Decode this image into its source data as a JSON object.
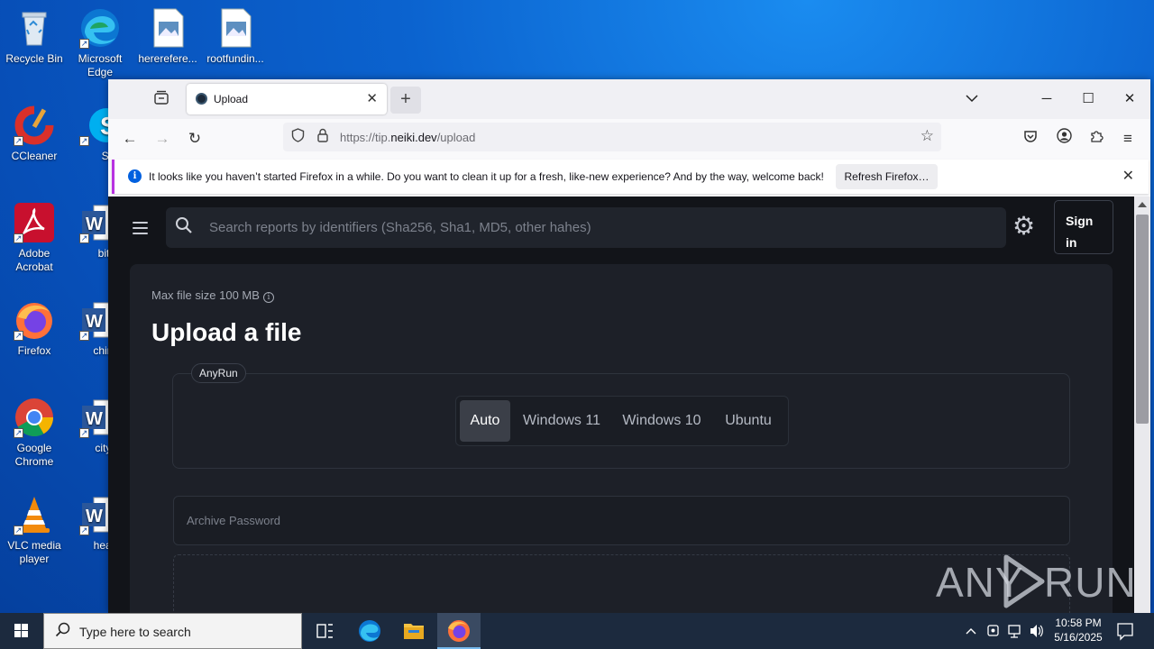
{
  "desktop": {
    "icons": [
      {
        "label": "Recycle Bin"
      },
      {
        "label": "Microsoft Edge"
      },
      {
        "label": "hererefere..."
      },
      {
        "label": "rootfundin..."
      },
      {
        "label": "CCleaner"
      },
      {
        "label": "Skyp"
      },
      {
        "label": "Adobe Acrobat"
      },
      {
        "label": "bitaug"
      },
      {
        "label": "Firefox"
      },
      {
        "label": "chinaca"
      },
      {
        "label": "Google Chrome"
      },
      {
        "label": "cityyea"
      },
      {
        "label": "VLC media player"
      },
      {
        "label": "heartpu"
      }
    ]
  },
  "browser": {
    "tab": {
      "title": "Upload"
    },
    "url": {
      "prefix": "https://tip.",
      "domain": "neiki.dev",
      "path": "/upload"
    },
    "notification": {
      "message": "It looks like you haven’t started Firefox in a while. Do you want to clean it up for a fresh, like-new experience? And by the way, welcome back!",
      "button": "Refresh Firefox…"
    }
  },
  "page": {
    "search_placeholder": "Search reports by identifiers (Sha256, Sha1, MD5, other hahes)",
    "signin": "Sign in",
    "max_file_size": "Max file size 100 MB",
    "heading": "Upload a file",
    "sandbox_tag": "AnyRun",
    "os_options": [
      {
        "label": "Auto",
        "active": true
      },
      {
        "label": "Windows 11",
        "active": false
      },
      {
        "label": "Windows 10",
        "active": false
      },
      {
        "label": "Ubuntu",
        "active": false
      }
    ],
    "archive_password_placeholder": "Archive Password",
    "watermark": "ANY RUN"
  },
  "taskbar": {
    "search_text": "Type here to search",
    "time": "10:58 PM",
    "date": "5/16/2025"
  },
  "colors": {
    "accent_notification": "#b833e1",
    "page_bg": "#121419",
    "card_bg": "#1d2028"
  }
}
